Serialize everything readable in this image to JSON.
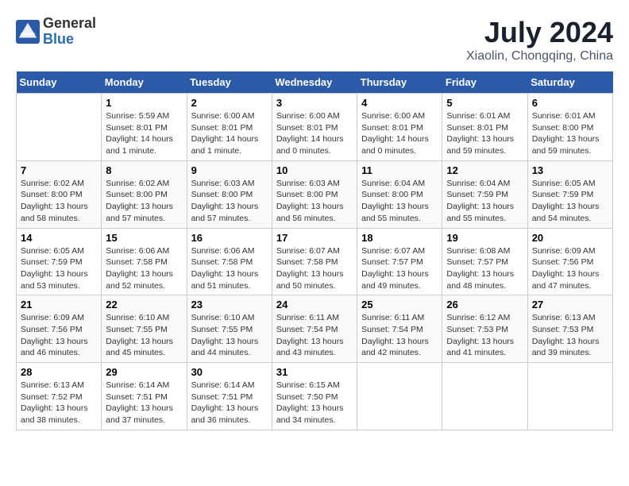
{
  "header": {
    "logo_general": "General",
    "logo_blue": "Blue",
    "title": "July 2024",
    "subtitle": "Xiaolin, Chongqing, China"
  },
  "weekdays": [
    "Sunday",
    "Monday",
    "Tuesday",
    "Wednesday",
    "Thursday",
    "Friday",
    "Saturday"
  ],
  "weeks": [
    [
      {
        "day": "",
        "info": ""
      },
      {
        "day": "1",
        "info": "Sunrise: 5:59 AM\nSunset: 8:01 PM\nDaylight: 14 hours\nand 1 minute."
      },
      {
        "day": "2",
        "info": "Sunrise: 6:00 AM\nSunset: 8:01 PM\nDaylight: 14 hours\nand 1 minute."
      },
      {
        "day": "3",
        "info": "Sunrise: 6:00 AM\nSunset: 8:01 PM\nDaylight: 14 hours\nand 0 minutes."
      },
      {
        "day": "4",
        "info": "Sunrise: 6:00 AM\nSunset: 8:01 PM\nDaylight: 14 hours\nand 0 minutes."
      },
      {
        "day": "5",
        "info": "Sunrise: 6:01 AM\nSunset: 8:01 PM\nDaylight: 13 hours\nand 59 minutes."
      },
      {
        "day": "6",
        "info": "Sunrise: 6:01 AM\nSunset: 8:00 PM\nDaylight: 13 hours\nand 59 minutes."
      }
    ],
    [
      {
        "day": "7",
        "info": "Sunrise: 6:02 AM\nSunset: 8:00 PM\nDaylight: 13 hours\nand 58 minutes."
      },
      {
        "day": "8",
        "info": "Sunrise: 6:02 AM\nSunset: 8:00 PM\nDaylight: 13 hours\nand 57 minutes."
      },
      {
        "day": "9",
        "info": "Sunrise: 6:03 AM\nSunset: 8:00 PM\nDaylight: 13 hours\nand 57 minutes."
      },
      {
        "day": "10",
        "info": "Sunrise: 6:03 AM\nSunset: 8:00 PM\nDaylight: 13 hours\nand 56 minutes."
      },
      {
        "day": "11",
        "info": "Sunrise: 6:04 AM\nSunset: 8:00 PM\nDaylight: 13 hours\nand 55 minutes."
      },
      {
        "day": "12",
        "info": "Sunrise: 6:04 AM\nSunset: 7:59 PM\nDaylight: 13 hours\nand 55 minutes."
      },
      {
        "day": "13",
        "info": "Sunrise: 6:05 AM\nSunset: 7:59 PM\nDaylight: 13 hours\nand 54 minutes."
      }
    ],
    [
      {
        "day": "14",
        "info": "Sunrise: 6:05 AM\nSunset: 7:59 PM\nDaylight: 13 hours\nand 53 minutes."
      },
      {
        "day": "15",
        "info": "Sunrise: 6:06 AM\nSunset: 7:58 PM\nDaylight: 13 hours\nand 52 minutes."
      },
      {
        "day": "16",
        "info": "Sunrise: 6:06 AM\nSunset: 7:58 PM\nDaylight: 13 hours\nand 51 minutes."
      },
      {
        "day": "17",
        "info": "Sunrise: 6:07 AM\nSunset: 7:58 PM\nDaylight: 13 hours\nand 50 minutes."
      },
      {
        "day": "18",
        "info": "Sunrise: 6:07 AM\nSunset: 7:57 PM\nDaylight: 13 hours\nand 49 minutes."
      },
      {
        "day": "19",
        "info": "Sunrise: 6:08 AM\nSunset: 7:57 PM\nDaylight: 13 hours\nand 48 minutes."
      },
      {
        "day": "20",
        "info": "Sunrise: 6:09 AM\nSunset: 7:56 PM\nDaylight: 13 hours\nand 47 minutes."
      }
    ],
    [
      {
        "day": "21",
        "info": "Sunrise: 6:09 AM\nSunset: 7:56 PM\nDaylight: 13 hours\nand 46 minutes."
      },
      {
        "day": "22",
        "info": "Sunrise: 6:10 AM\nSunset: 7:55 PM\nDaylight: 13 hours\nand 45 minutes."
      },
      {
        "day": "23",
        "info": "Sunrise: 6:10 AM\nSunset: 7:55 PM\nDaylight: 13 hours\nand 44 minutes."
      },
      {
        "day": "24",
        "info": "Sunrise: 6:11 AM\nSunset: 7:54 PM\nDaylight: 13 hours\nand 43 minutes."
      },
      {
        "day": "25",
        "info": "Sunrise: 6:11 AM\nSunset: 7:54 PM\nDaylight: 13 hours\nand 42 minutes."
      },
      {
        "day": "26",
        "info": "Sunrise: 6:12 AM\nSunset: 7:53 PM\nDaylight: 13 hours\nand 41 minutes."
      },
      {
        "day": "27",
        "info": "Sunrise: 6:13 AM\nSunset: 7:53 PM\nDaylight: 13 hours\nand 39 minutes."
      }
    ],
    [
      {
        "day": "28",
        "info": "Sunrise: 6:13 AM\nSunset: 7:52 PM\nDaylight: 13 hours\nand 38 minutes."
      },
      {
        "day": "29",
        "info": "Sunrise: 6:14 AM\nSunset: 7:51 PM\nDaylight: 13 hours\nand 37 minutes."
      },
      {
        "day": "30",
        "info": "Sunrise: 6:14 AM\nSunset: 7:51 PM\nDaylight: 13 hours\nand 36 minutes."
      },
      {
        "day": "31",
        "info": "Sunrise: 6:15 AM\nSunset: 7:50 PM\nDaylight: 13 hours\nand 34 minutes."
      },
      {
        "day": "",
        "info": ""
      },
      {
        "day": "",
        "info": ""
      },
      {
        "day": "",
        "info": ""
      }
    ]
  ]
}
